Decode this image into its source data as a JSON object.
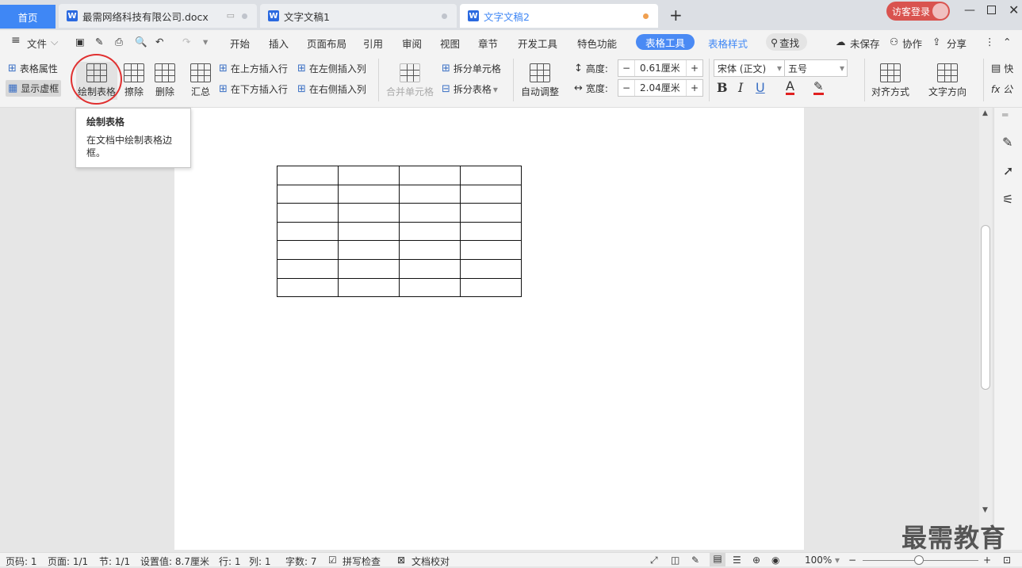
{
  "tabs": {
    "home": "首页",
    "tab1": "最需网络科技有限公司.docx",
    "tab2": "文字文稿1",
    "tab3": "文字文稿2",
    "add": "+"
  },
  "login": "访客登录",
  "menu": {
    "file": "文件",
    "items": [
      "开始",
      "插入",
      "页面布局",
      "引用",
      "审阅",
      "视图",
      "章节",
      "开发工具",
      "特色功能"
    ],
    "active_tab": "表格工具",
    "table_style": "表格样式",
    "search": "查找",
    "unsaved": "未保存",
    "collab": "协作",
    "share": "分享"
  },
  "ribbon": {
    "table_props": "表格属性",
    "show_grid": "显示虚框",
    "draw_table": "绘制表格",
    "erase": "擦除",
    "delete": "删除",
    "summary": "汇总",
    "insert_above": "在上方插入行",
    "insert_below": "在下方插入行",
    "insert_left": "在左侧插入列",
    "insert_right": "在右侧插入列",
    "merge_cells": "合并单元格",
    "split_cells": "拆分单元格",
    "split_table": "拆分表格",
    "auto_fit": "自动调整",
    "height_label": "高度:",
    "height_value": "0.61厘米",
    "width_label": "宽度:",
    "width_value": "2.04厘米",
    "font_name": "宋体 (正文)",
    "font_size": "五号",
    "align": "对齐方式",
    "text_dir": "文字方向",
    "quick": "快",
    "fx": "fx 公"
  },
  "tooltip": {
    "title": "绘制表格",
    "body": "在文档中绘制表格边框。"
  },
  "table": {
    "rows": 7,
    "cols": 4
  },
  "status": {
    "page_num": "页码: 1",
    "pages": "页面: 1/1",
    "section": "节: 1/1",
    "setting": "设置值: 8.7厘米",
    "row": "行: 1",
    "col": "列: 1",
    "words": "字数: 7",
    "spell": "拼写检查",
    "proof": "文档校对",
    "zoom": "100%"
  },
  "watermark": "最需教育",
  "colors": {
    "accent": "#3f87f5",
    "active_pill": "#4a8af4",
    "highlight_circle": "#e03030"
  }
}
